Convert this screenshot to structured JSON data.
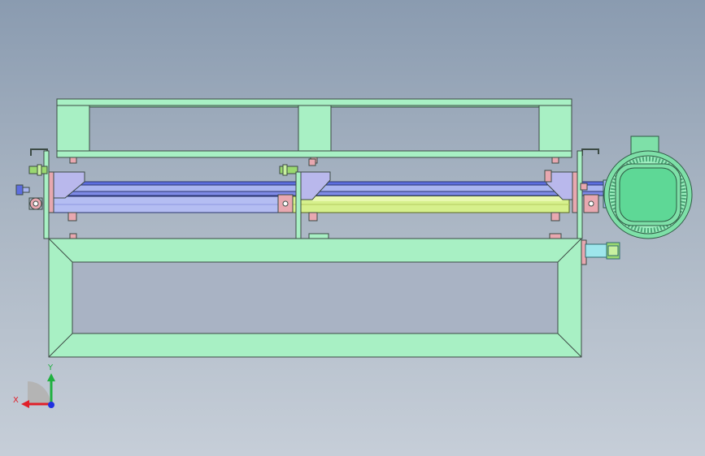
{
  "viewport": {
    "background_top": "#8a9bb0",
    "background_bottom": "#c6ced8"
  },
  "colors": {
    "frame_green": "#a8f0c4",
    "frame_edge": "#3c4a44",
    "roller_blue": "#a9b4f0",
    "roller_blue_dark": "#5d6ee0",
    "roller_yellow": "#d6f08c",
    "bracket_pink": "#e8a8b0",
    "bracket_lavender": "#b9b8ec",
    "bolt_green": "#9ad870",
    "motor_green": "#7ee0a8",
    "shaft_cyan": "#9ee6ec"
  },
  "triad": {
    "x_label": "X",
    "y_label": "Y",
    "x_color": "#e0202a",
    "y_color": "#20b040",
    "z_color": "#2030e0"
  },
  "parts": [
    "top-frame",
    "upper-roller",
    "lower-roller-left",
    "lower-roller-right",
    "bearing-bracket-left",
    "bearing-bracket-middle",
    "bearing-bracket-right",
    "bottom-frame",
    "motor",
    "motor-shaft"
  ]
}
